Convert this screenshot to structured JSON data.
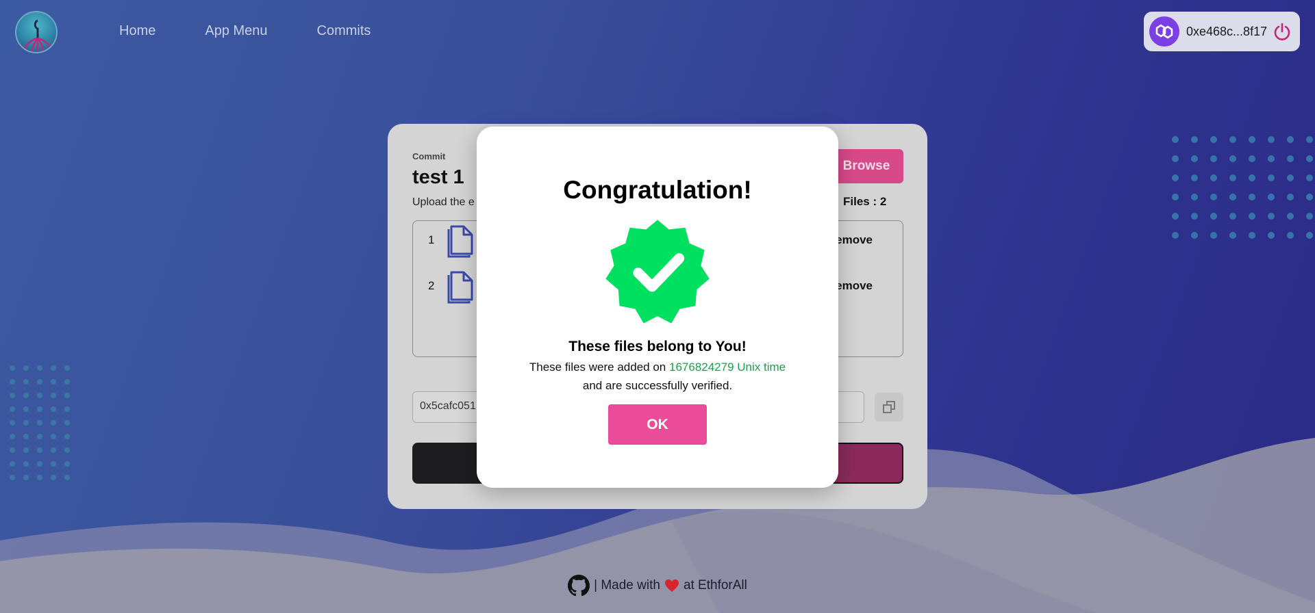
{
  "nav": {
    "items": [
      {
        "label": "Home"
      },
      {
        "label": "App Menu"
      },
      {
        "label": "Commits"
      }
    ]
  },
  "wallet": {
    "address": "0xe468c...8f17"
  },
  "card": {
    "section_label": "Commit",
    "title": "test 1",
    "subtitle": "Upload the e",
    "browse_label": "Browse",
    "files_count": "Files : 2",
    "files": [
      {
        "index": "1",
        "remove_label": "emove"
      },
      {
        "index": "2",
        "remove_label": "emove"
      }
    ],
    "hash_value": "0x5cafc051"
  },
  "modal": {
    "heading": "Congratulation!",
    "message_title": "These files belong to You!",
    "message_prefix": "These files were added on",
    "timestamp": "1676824279 Unix time",
    "message_suffix": "and are successfully verified.",
    "ok_label": "OK"
  },
  "footer": {
    "made_with": "| Made with",
    "at": "at EthforAll"
  },
  "colors": {
    "accent_pink": "#ea4c9a",
    "success_green": "#00e060",
    "timestamp_green": "#1e9e4a"
  }
}
